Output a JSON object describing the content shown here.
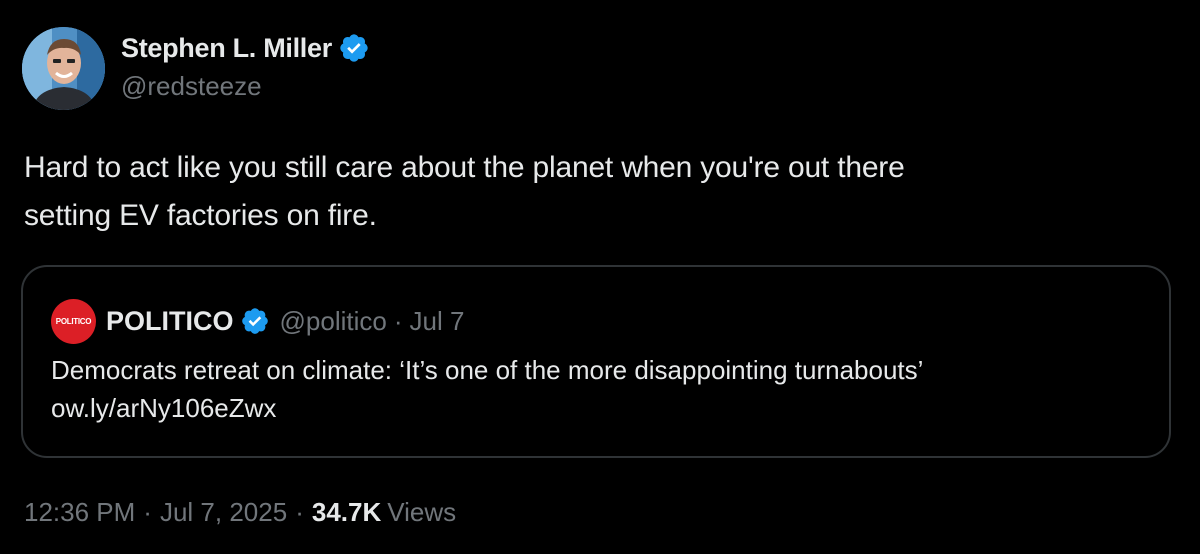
{
  "author": {
    "display_name": "Stephen L. Miller",
    "handle": "@redsteeze",
    "verified": true,
    "verified_color": "#1d9bf0"
  },
  "tweet": {
    "line1": "Hard to act like you still care about the planet when you're out there",
    "line2": "setting EV factories on fire."
  },
  "quote": {
    "avatar_text": "POLITICO",
    "avatar_color": "#dc1f26",
    "display_name": "POLITICO",
    "verified": true,
    "handle": "@politico",
    "separator": "·",
    "date": "Jul 7",
    "headline": "Democrats retreat on climate: ‘It’s one of the more disappointing turnabouts’",
    "link": "ow.ly/arNy106eZwx"
  },
  "meta": {
    "time": "12:36 PM",
    "separator": "·",
    "date": "Jul 7, 2025",
    "views_count": "34.7K",
    "views_label": "Views"
  },
  "colors": {
    "background": "#000000",
    "text_primary": "#e7e9ea",
    "text_secondary": "#71767b",
    "border": "#2f3336"
  }
}
